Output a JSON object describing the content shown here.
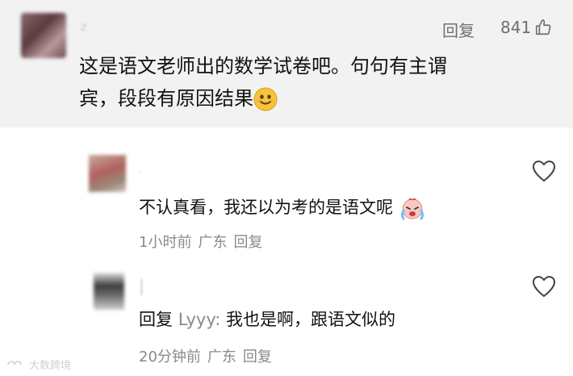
{
  "comment": {
    "reply_label": "回复",
    "like_count": "841",
    "text_line1": "这是语文老师出的数学试卷吧。句句有主谓",
    "text_line2": "宾，段段有原因结果"
  },
  "replies": [
    {
      "text": "不认真看，我还以为考的是语文呢",
      "time": "1小时前",
      "location": "广东",
      "reply_label": "回复"
    },
    {
      "prefix": "回复",
      "reply_to": "Lyyy:",
      "text": "我也是啊，跟语文似的",
      "time": "20分钟前",
      "location": "广东",
      "reply_label": "回复"
    }
  ],
  "watermark": "大数跨境",
  "colors": {
    "top_band": "#f2f2f2",
    "muted_text": "#8a8a8a",
    "primary_text": "#111111"
  },
  "icons": [
    "thumbs-up-icon",
    "heart-icon",
    "smile-emoji-icon",
    "crying-emoji-icon"
  ]
}
